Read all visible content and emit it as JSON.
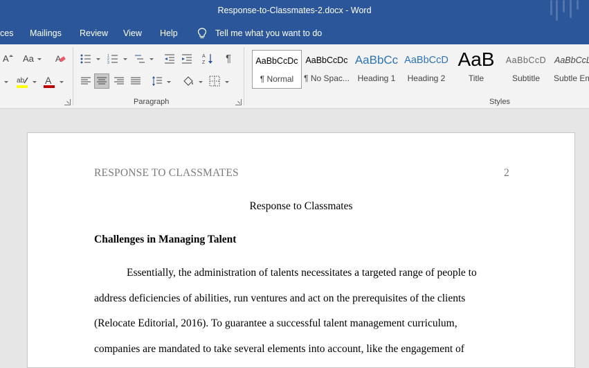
{
  "window": {
    "title": "Response-to-Classmates-2.docx  -  Word"
  },
  "menu": {
    "items": [
      "ces",
      "Mailings",
      "Review",
      "View",
      "Help"
    ],
    "tell_me": "Tell me what you want to do"
  },
  "ribbon": {
    "font_group": {
      "grow_font": "A",
      "change_case": "Aa",
      "font_color_glyph": "A"
    },
    "paragraph_group": {
      "label": "Paragraph",
      "show_marks": "¶"
    },
    "styles_group": {
      "label": "Styles",
      "items": [
        {
          "sample": "AaBbCcDc",
          "name": "¶ Normal",
          "selected": true
        },
        {
          "sample": "AaBbCcDc",
          "name": "¶ No Spac..."
        },
        {
          "sample": "AaBbCc",
          "name": "Heading 1"
        },
        {
          "sample": "AaBbCcD",
          "name": "Heading 2"
        },
        {
          "sample": "AaB",
          "name": "Title"
        },
        {
          "sample": "AaBbCcD",
          "name": "Subtitle"
        },
        {
          "sample": "AaBbCcL",
          "name": "Subtle Em"
        }
      ]
    }
  },
  "colors": {
    "word_blue": "#2b579a",
    "highlight_yellow": "#ffff00",
    "font_red": "#c00000"
  },
  "document": {
    "running_head": "RESPONSE TO CLASSMATES",
    "page_number": "2",
    "title": "Response to Classmates",
    "heading": "Challenges in Managing Talent",
    "lines": [
      "Essentially, the administration of talents necessitates a targeted range of people to",
      "address deficiencies of abilities, run ventures and act on the prerequisites of the clients",
      "(Relocate Editorial, 2016). To guarantee a successful talent management curriculum,",
      "companies are mandated to take several elements into account, like the engagement of"
    ]
  }
}
